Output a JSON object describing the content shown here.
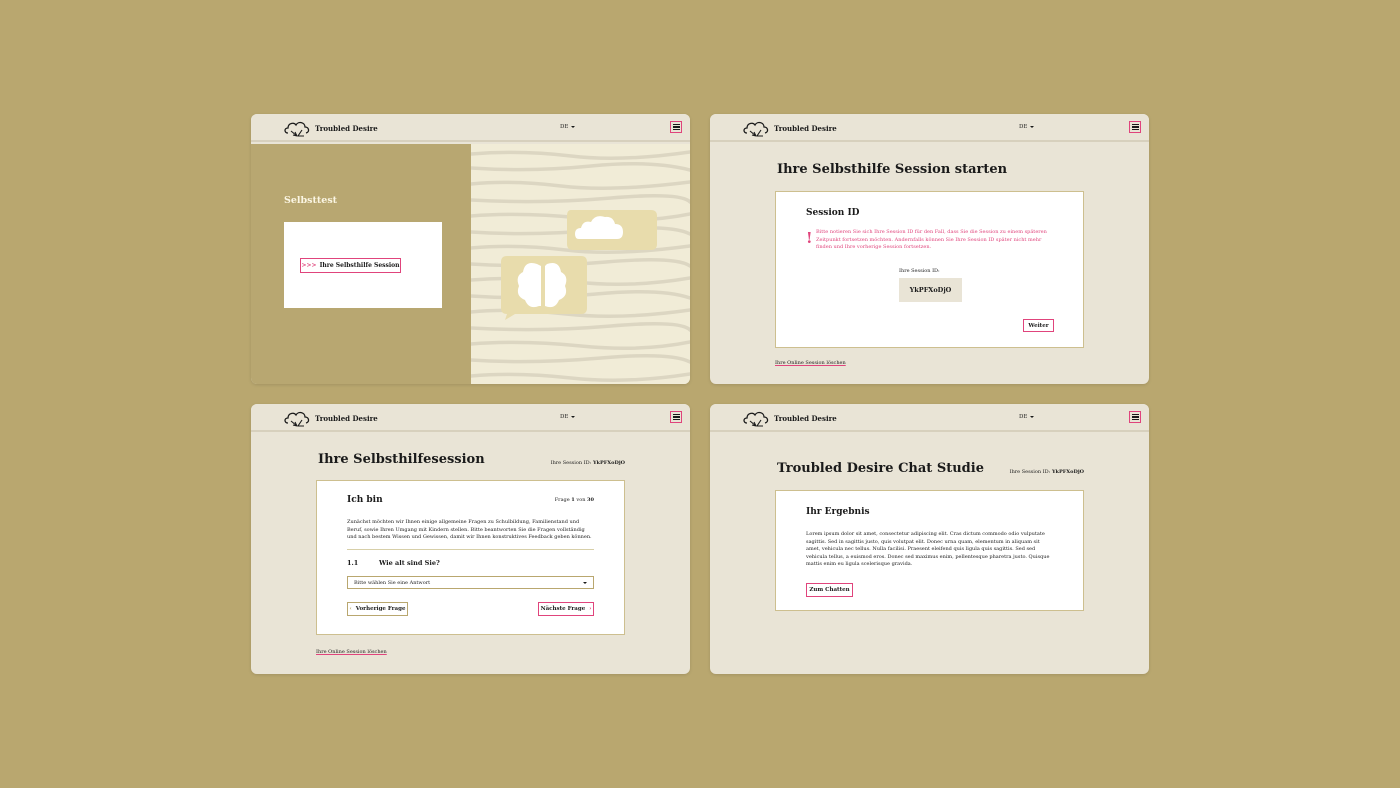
{
  "brand": "Troubled Desire",
  "lang": "DE",
  "colors": {
    "accent": "#e0447c",
    "olive": "#b9a76f",
    "panel": "#e9e4d6"
  },
  "screen1": {
    "title": "Selbsttest",
    "button_prefix": ">>>",
    "button_label": "Ihre Selbsthilfe Session"
  },
  "screen2": {
    "heading": "Ihre Selbsthilfe Session starten",
    "card_title": "Session ID",
    "warning": "Bitte notieren Sie sich Ihre Session ID für den Fall, dass Sie die Session zu einem späteren Zeitpunkt fortsetzen möchten. Andernfalls können Sie Ihre Session ID später nicht mehr finden und Ihre vorherige Session fortsetzen.",
    "id_label": "Ihre Session ID:",
    "id_value": "YkPFXoDjO",
    "next_button": "Weiter",
    "delete_link": "Ihre Online Session löschen"
  },
  "screen3": {
    "heading": "Ihre Selbsthilfesession",
    "session_label": "Ihre Session ID:",
    "session_id": "YkPFXoDjO",
    "card_title": "Ich bin",
    "progress_prefix": "Frage",
    "progress_current": "1",
    "progress_sep": "von",
    "progress_total": "30",
    "intro": "Zunächst möchten wir Ihnen einige allgemeine Fragen zu Schulbildung, Familienstand und Beruf, sowie Ihren Umgang mit Kindern stellen. Bitte beantworten Sie die Fragen vollständig und nach bestem Wissen und Gewissen, damit wir Ihnen konstruktives Feedback geben können.",
    "question_number": "1.1",
    "question": "Wie alt sind Sie?",
    "select_placeholder": "Bitte wählen Sie eine Antwort",
    "prev_button": "Vorherige Frage",
    "next_button": "Nächste Frage",
    "delete_link": "Ihre Online Session löschen"
  },
  "screen4": {
    "heading": "Troubled Desire Chat Studie",
    "session_label": "Ihre Session ID:",
    "session_id": "YkPFXoDjO",
    "card_title": "Ihr Ergebnis",
    "body": "Lorem ipsum dolor sit amet, consectetur adipiscing elit. Cras dictum commodo odio vulputate sagittis. Sed in sagittis justo, quis volutpat elit. Donec urna quam, elementum in aliquam sit amet, vehicula nec tellus. Nulla facilisi. Praesent eleifend quis ligula quis sagittis. Sed sed vehicula tellus, a euismod eros. Donec sed maximus enim, pellentesque pharetra justo. Quisque mattis enim eu ligula scelerisque gravida.",
    "chat_button": "Zum Chatten"
  }
}
